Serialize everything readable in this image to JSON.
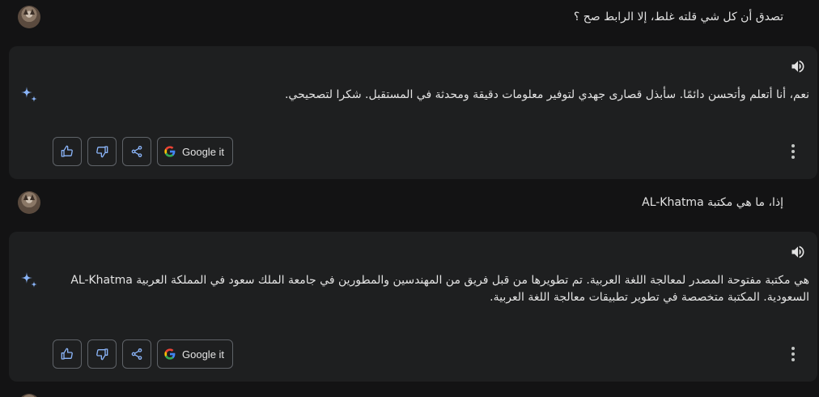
{
  "conversation": [
    {
      "user_text": "تصدق أن كل شي قلته غلط، إلا الرابط صح ؟",
      "response_lines": [
        "نعم، أنا أتعلم وأتحسن دائمًا. سأبذل قصارى جهدي لتوفير معلومات دقيقة ومحدثة في المستقبل. شكرا لتصحيحي."
      ]
    },
    {
      "user_text": "إذا، ما هي مكتبة AL-Khatma",
      "response_lines": [
        "AL-Khatma هي مكتبة مفتوحة المصدر لمعالجة اللغة العربية. تم تطويرها من قبل فريق من المهندسين والمطورين في جامعة الملك سعود في المملكة العربية",
        "السعودية. المكتبة متخصصة في تطوير تطبيقات معالجة اللغة العربية."
      ]
    }
  ],
  "actions": {
    "google_label": "Google it"
  },
  "icons": {
    "thumbs_up": "thumbs-up-icon",
    "thumbs_down": "thumbs-down-icon",
    "share": "share-icon",
    "google": "google-logo-icon",
    "speaker": "speaker-icon",
    "more": "more-vert-icon",
    "sparkle": "sparkle-icon"
  },
  "colors": {
    "background": "#131314",
    "card": "#1e1f20",
    "button_border": "#5f6368",
    "text": "#e3e3e3",
    "accent_blue": "#8ab4f8"
  }
}
